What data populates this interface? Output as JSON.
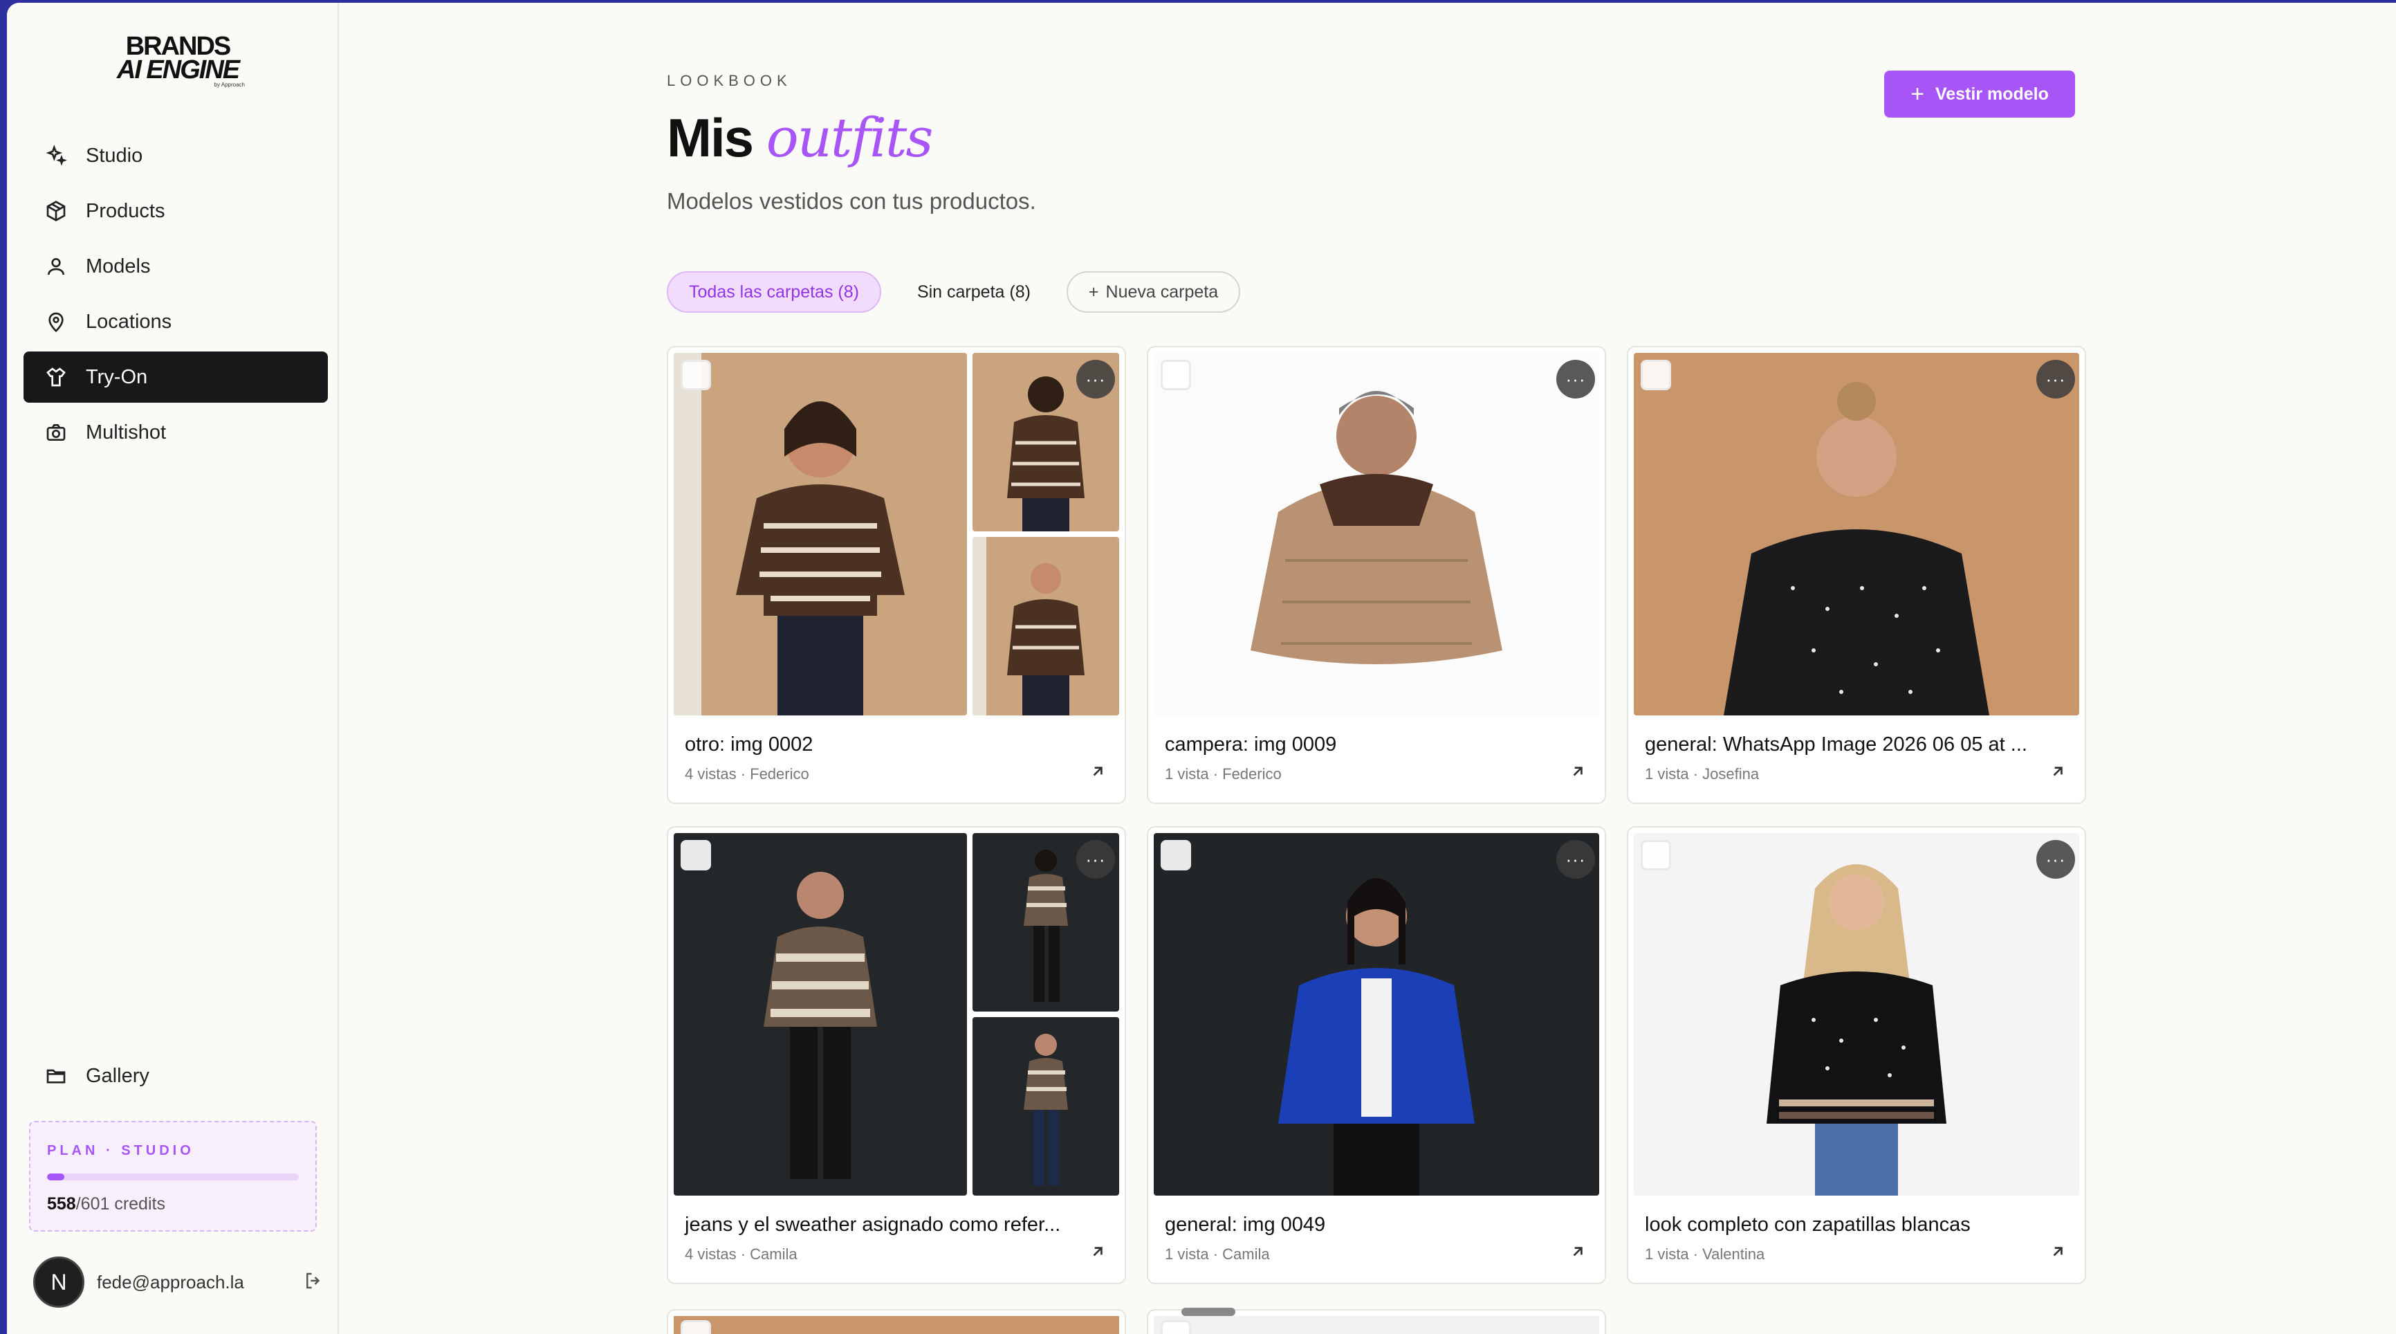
{
  "brand": {
    "line1": "BRANDS",
    "line2": "AI ENGINE",
    "line3": "by Approach"
  },
  "sidebar": {
    "items": [
      {
        "label": "Studio",
        "icon": "sparkles-icon",
        "active": false
      },
      {
        "label": "Products",
        "icon": "box-icon",
        "active": false
      },
      {
        "label": "Models",
        "icon": "user-icon",
        "active": false
      },
      {
        "label": "Locations",
        "icon": "map-pin-icon",
        "active": false
      },
      {
        "label": "Try-On",
        "icon": "shirt-icon",
        "active": true
      },
      {
        "label": "Multishot",
        "icon": "camera-icon",
        "active": false
      }
    ],
    "gallery": {
      "label": "Gallery",
      "icon": "folder-icon"
    },
    "plan": {
      "label": "PLAN · STUDIO",
      "used": "558",
      "total": "/601 credits",
      "progress": 0.07
    },
    "user": {
      "initial": "N",
      "email": "fede@approach.la"
    }
  },
  "header": {
    "kicker": "LOOKBOOK",
    "title_plain": "Mis",
    "title_accent": "outfits",
    "subtitle": "Modelos vestidos con tus productos.",
    "cta_icon": "+",
    "cta_label": "Vestir modelo"
  },
  "filters": {
    "all": "Todas las carpetas (8)",
    "none": "Sin carpeta (8)",
    "new_icon": "+",
    "new": "Nueva carpeta"
  },
  "cards": [
    {
      "title": "otro: img 0002",
      "meta": "4 vistas · Federico"
    },
    {
      "title": "campera: img 0009",
      "meta": "1 vista · Federico"
    },
    {
      "title": "general: WhatsApp Image 2026 06 05 at ...",
      "meta": "1 vista · Josefina"
    },
    {
      "title": "jeans y el sweather asignado como refer...",
      "meta": "4 vistas · Camila"
    },
    {
      "title": "general: img 0049",
      "meta": "1 vista · Camila"
    },
    {
      "title": "look completo con zapatillas blancas",
      "meta": "1 vista · Valentina"
    }
  ],
  "menu_glyph": "···",
  "colors": {
    "accent": "#a855f7",
    "active_nav": "#18181b"
  }
}
